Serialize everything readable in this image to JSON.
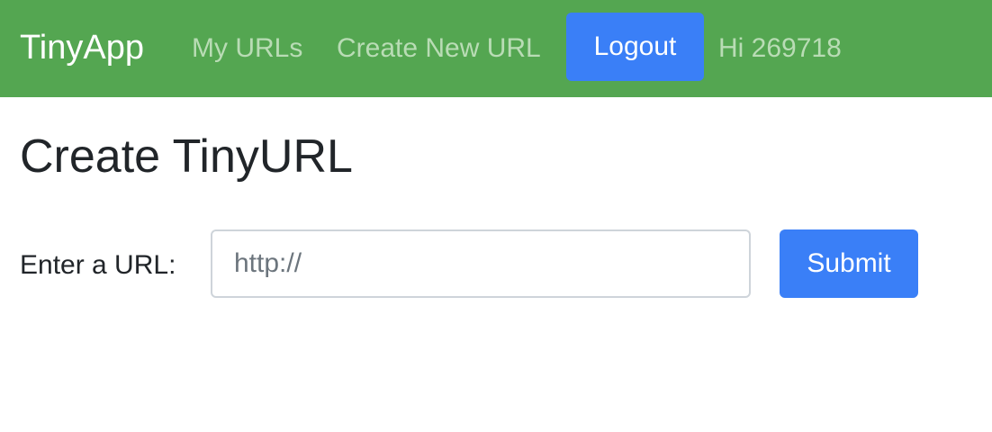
{
  "navbar": {
    "brand": "TinyApp",
    "links": [
      {
        "label": "My URLs"
      },
      {
        "label": "Create New URL"
      }
    ],
    "logout_label": "Logout",
    "greeting": "Hi 269718",
    "background_color": "#54a651",
    "link_color": "#b9dcb5"
  },
  "main": {
    "title": "Create TinyURL",
    "form": {
      "label": "Enter a URL:",
      "input_value": "",
      "input_placeholder": "http://",
      "submit_label": "Submit"
    }
  },
  "colors": {
    "primary_button": "#3a7ff7",
    "text": "#212529"
  }
}
